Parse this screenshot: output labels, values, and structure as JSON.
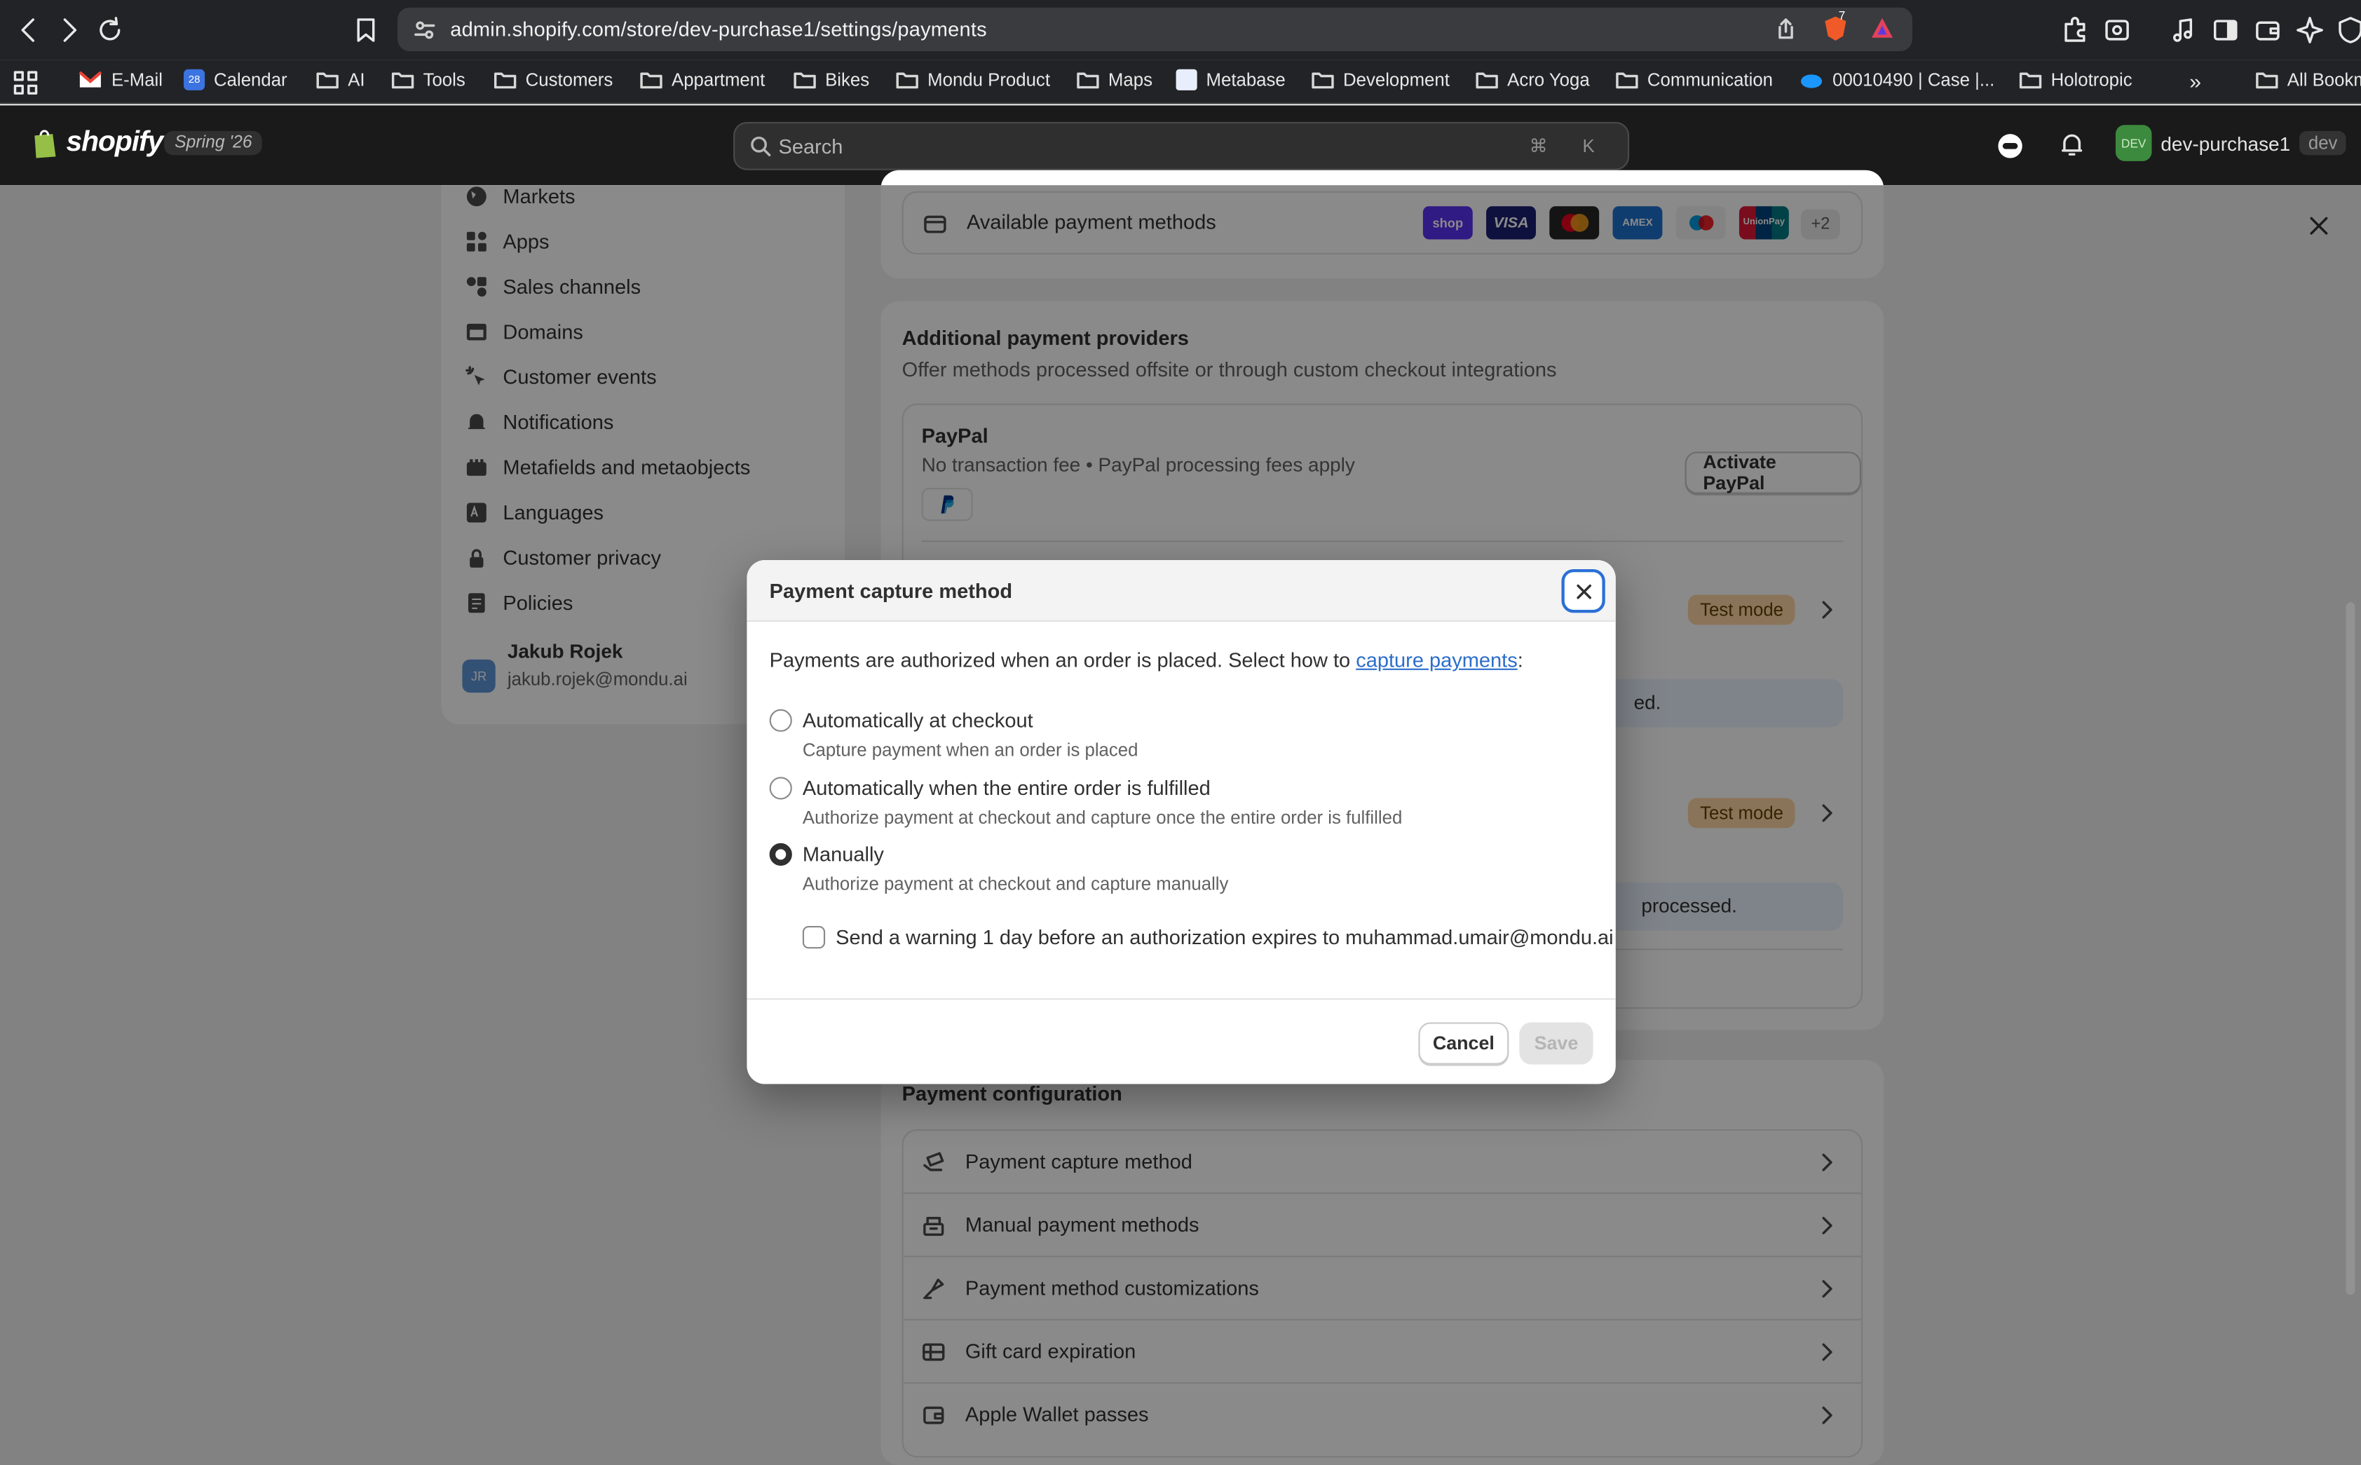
{
  "browser": {
    "url": "admin.shopify.com/store/dev-purchase1/settings/payments",
    "bookmarks": [
      "E-Mail",
      "Calendar",
      "AI",
      "Tools",
      "Customers",
      "Appartment",
      "Bikes",
      "Mondu Product",
      "Maps",
      "Metabase",
      "Development",
      "Acro Yoga",
      "Communication",
      "00010490 | Case |...",
      "Holotropic",
      "All Bookm"
    ],
    "calendar_day": "28",
    "brave_count": "7",
    "overflow": "»"
  },
  "topbar": {
    "logo": "shopify",
    "release": "Spring '26",
    "search_placeholder": "Search",
    "search_shortcut": "⌘ K",
    "avatar_initials": "DEV",
    "store_name": "dev-purchase1",
    "env_badge": "dev"
  },
  "sidebar": {
    "items": [
      "Markets",
      "Apps",
      "Sales channels",
      "Domains",
      "Customer events",
      "Notifications",
      "Metafields and metaobjects",
      "Languages",
      "Customer privacy",
      "Policies"
    ],
    "user": {
      "initials": "JR",
      "name": "Jakub Rojek",
      "email": "jakub.rojek@mondu.ai"
    }
  },
  "payments": {
    "available_methods_label": "Available payment methods",
    "method_logos": [
      "shop",
      "VISA",
      "Mastercard",
      "AMEX",
      "Maestro",
      "UnionPay"
    ],
    "more_count": "+2",
    "providers_title": "Additional payment providers",
    "providers_subtitle": "Offer methods processed offsite or through custom checkout integrations",
    "paypal": {
      "name": "PayPal",
      "description": "No transaction fee • PayPal processing fees apply",
      "button": "Activate PayPal"
    },
    "test_mode_badge": "Test mode",
    "info_text_1": "ed.",
    "info_text_2": "processed.",
    "config_title": "Payment configuration",
    "config_items": [
      "Payment capture method",
      "Manual payment methods",
      "Payment method customizations",
      "Gift card expiration",
      "Apple Wallet passes"
    ]
  },
  "modal": {
    "title": "Payment capture method",
    "intro_prefix": "Payments are authorized when an order is placed. Select how to ",
    "intro_link": "capture payments",
    "intro_suffix": ":",
    "options": [
      {
        "label": "Automatically at checkout",
        "description": "Capture payment when an order is placed",
        "selected": false
      },
      {
        "label": "Automatically when the entire order is fulfilled",
        "description": "Authorize payment at checkout and capture once the entire order is fulfilled",
        "selected": false
      },
      {
        "label": "Manually",
        "description": "Authorize payment at checkout and capture manually",
        "selected": true
      }
    ],
    "warning_label": "Send a warning 1 day before an authorization expires to muhammad.umair@mondu.ai",
    "warning_checked": false,
    "cancel": "Cancel",
    "save": "Save"
  }
}
